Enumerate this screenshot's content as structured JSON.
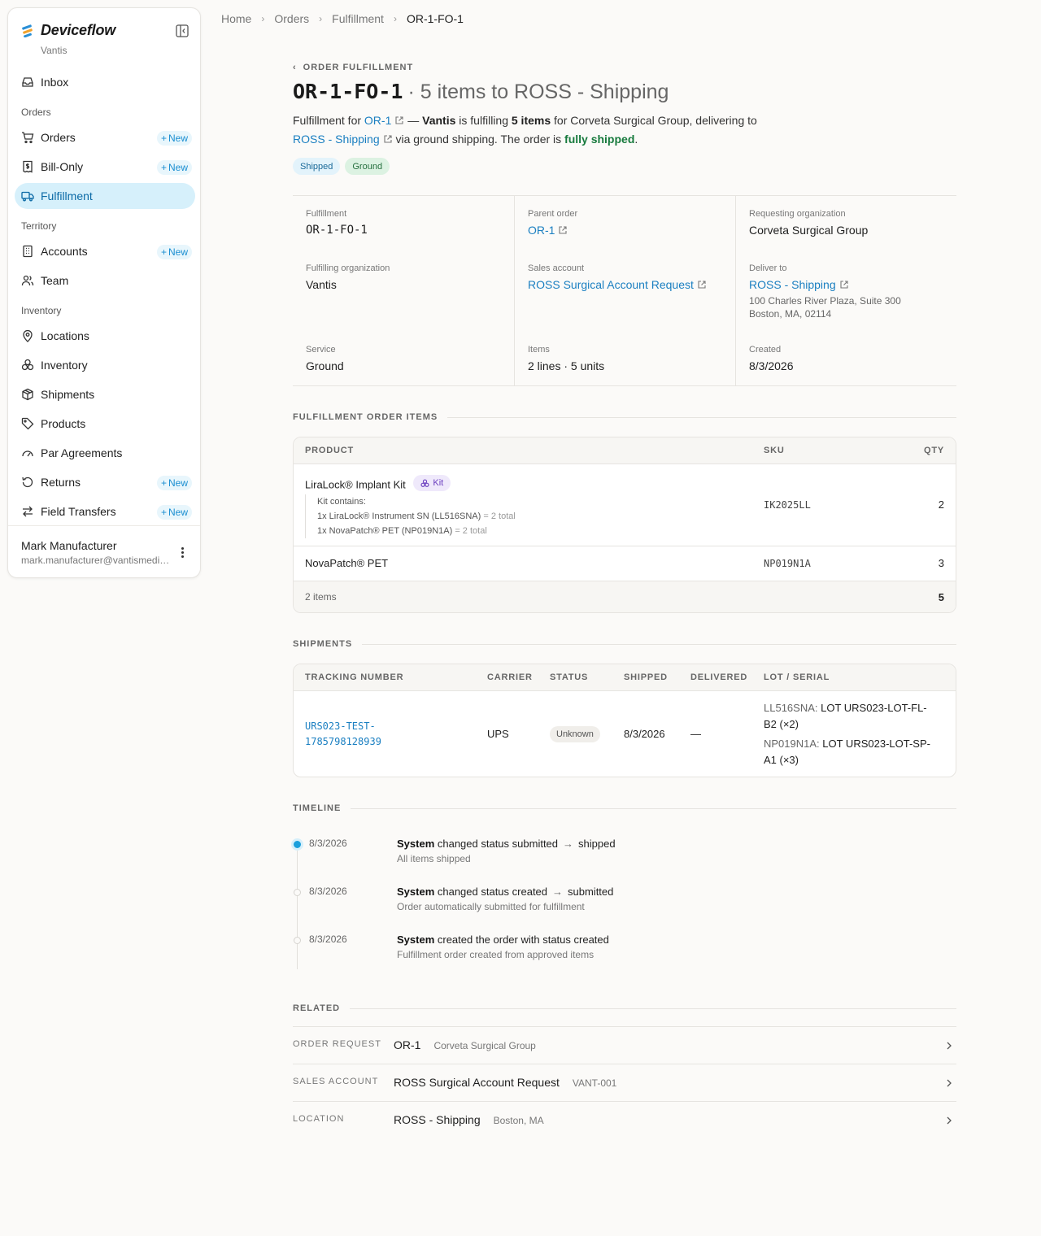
{
  "app": {
    "name": "Deviceflow",
    "org": "Vantis"
  },
  "sidebar": {
    "inbox": "Inbox",
    "sections": {
      "orders": "Orders",
      "territory": "Territory",
      "inventory": "Inventory"
    },
    "items": {
      "orders": "Orders",
      "bill_only": "Bill-Only",
      "fulfillment": "Fulfillment",
      "accounts": "Accounts",
      "team": "Team",
      "locations": "Locations",
      "inventory": "Inventory",
      "shipments": "Shipments",
      "products": "Products",
      "par_agreements": "Par Agreements",
      "returns": "Returns",
      "field_transfers": "Field Transfers"
    },
    "new_label": "New",
    "user": {
      "name": "Mark Manufacturer",
      "email": "mark.manufacturer@vantismedical.com"
    }
  },
  "breadcrumb": [
    "Home",
    "Orders",
    "Fulfillment",
    "OR-1-FO-1"
  ],
  "header": {
    "back_label": "ORDER FULFILLMENT",
    "title_id": "OR-1-FO-1",
    "title_rest": "· 5 items to ROSS - Shipping",
    "summary": {
      "p1": "Fulfillment for ",
      "order_link": "OR-1",
      "p2": " — ",
      "org": "Vantis",
      "p3": " is fulfilling ",
      "count": "5 items",
      "p4": " for Corveta Surgical Group, delivering to",
      "dest_link": "ROSS - Shipping",
      "p5": " via ground shipping. The order is ",
      "status": "fully shipped",
      "p6": "."
    },
    "pills": [
      "Shipped",
      "Ground"
    ]
  },
  "info": {
    "fulfillment": {
      "k": "Fulfillment",
      "v": "OR-1-FO-1"
    },
    "parent_order": {
      "k": "Parent order",
      "v": "OR-1"
    },
    "requesting_org": {
      "k": "Requesting organization",
      "v": "Corveta Surgical Group"
    },
    "fulfilling_org": {
      "k": "Fulfilling organization",
      "v": "Vantis"
    },
    "sales_account": {
      "k": "Sales account",
      "v": "ROSS Surgical Account Request"
    },
    "deliver_to": {
      "k": "Deliver to",
      "v": "ROSS - Shipping",
      "addr1": "100 Charles River Plaza, Suite 300",
      "addr2": "Boston, MA, 02114"
    },
    "service": {
      "k": "Service",
      "v": "Ground"
    },
    "items": {
      "k": "Items",
      "v": "2 lines · 5 units"
    },
    "created": {
      "k": "Created",
      "v": "8/3/2026"
    }
  },
  "items_section": {
    "title": "FULFILLMENT ORDER ITEMS",
    "headers": {
      "product": "PRODUCT",
      "sku": "SKU",
      "qty": "QTY"
    },
    "rows": [
      {
        "product": "LiraLock® Implant Kit",
        "badge": "Kit",
        "sku": "IK2025LL",
        "qty": "2",
        "kit_title": "Kit contains:",
        "kit_lines": [
          {
            "text": "1x LiraLock® Instrument SN (LL516SNA)",
            "total": " = 2 total"
          },
          {
            "text": "1x NovaPatch® PET (NP019N1A)",
            "total": " = 2 total"
          }
        ]
      },
      {
        "product": "NovaPatch® PET",
        "sku": "NP019N1A",
        "qty": "3"
      }
    ],
    "footer": {
      "label": "2 items",
      "total": "5"
    }
  },
  "shipments_section": {
    "title": "SHIPMENTS",
    "headers": {
      "tracking": "TRACKING NUMBER",
      "carrier": "CARRIER",
      "status": "STATUS",
      "shipped": "SHIPPED",
      "delivered": "DELIVERED",
      "lot": "LOT / SERIAL"
    },
    "row": {
      "tracking_1": "URS023-TEST-",
      "tracking_2": "1785798128939",
      "carrier": "UPS",
      "status": "Unknown",
      "shipped": "8/3/2026",
      "delivered": "—",
      "lots": [
        {
          "sku": "LL516SNA:",
          "l1": " LOT URS023-LOT-FL-",
          "l2": "B2 (×2)"
        },
        {
          "sku": "NP019N1A:",
          "l1": " LOT URS023-LOT-SP-",
          "l2": "A1 (×3)"
        }
      ]
    }
  },
  "timeline": {
    "title": "TIMELINE",
    "events": [
      {
        "date": "8/3/2026",
        "actor": "System",
        "action": " changed status submitted",
        "arrow": "→",
        "to": "shipped",
        "sub": "All items shipped"
      },
      {
        "date": "8/3/2026",
        "actor": "System",
        "action": " changed status created",
        "arrow": "→",
        "to": "submitted",
        "sub": "Order automatically submitted for fulfillment"
      },
      {
        "date": "8/3/2026",
        "actor": "System",
        "action": " created the order with status created",
        "arrow": "",
        "to": "",
        "sub": "Fulfillment order created from approved items"
      }
    ]
  },
  "related": {
    "title": "RELATED",
    "rows": [
      {
        "k": "ORDER REQUEST",
        "v": "OR-1",
        "sub": "Corveta Surgical Group"
      },
      {
        "k": "SALES ACCOUNT",
        "v": "ROSS Surgical Account Request",
        "sub": "VANT-001"
      },
      {
        "k": "LOCATION",
        "v": "ROSS - Shipping",
        "sub": "Boston, MA"
      }
    ]
  },
  "colors": {
    "accent": "#1a7fc1",
    "active_bg": "#d6f0fb",
    "success": "#177a3d",
    "kit": "#6b3fbf"
  }
}
